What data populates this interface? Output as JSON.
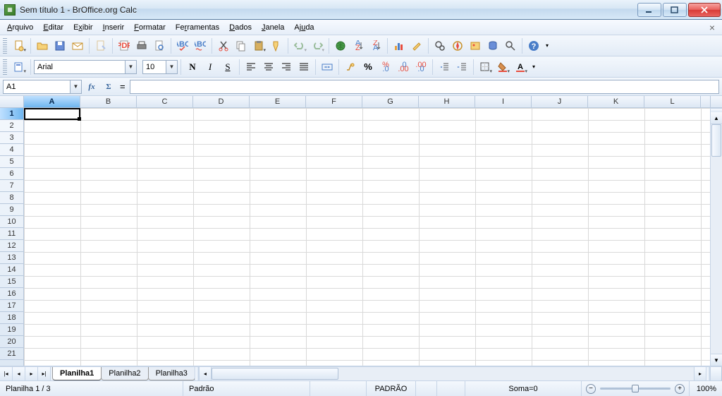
{
  "titlebar": {
    "title": "Sem título 1 - BrOffice.org Calc"
  },
  "menu": {
    "items": [
      {
        "label": "Arquivo",
        "accel": "A"
      },
      {
        "label": "Editar",
        "accel": "E"
      },
      {
        "label": "Exibir",
        "accel": "x"
      },
      {
        "label": "Inserir",
        "accel": "I"
      },
      {
        "label": "Formatar",
        "accel": "F"
      },
      {
        "label": "Ferramentas",
        "accel": "r"
      },
      {
        "label": "Dados",
        "accel": "D"
      },
      {
        "label": "Janela",
        "accel": "J"
      },
      {
        "label": "Ajuda",
        "accel": "u"
      }
    ]
  },
  "format_toolbar": {
    "font_name": "Arial",
    "font_size": "10",
    "bold_label": "N",
    "italic_label": "I",
    "underline_label": "S"
  },
  "formula_bar": {
    "cell_ref": "A1",
    "fx_label": "fx",
    "sigma_label": "Σ",
    "equals_label": "=",
    "formula_value": ""
  },
  "grid": {
    "columns": [
      "A",
      "B",
      "C",
      "D",
      "E",
      "F",
      "G",
      "H",
      "I",
      "J",
      "K",
      "L"
    ],
    "rows": [
      "1",
      "2",
      "3",
      "4",
      "5",
      "6",
      "7",
      "8",
      "9",
      "10",
      "11",
      "12",
      "13",
      "14",
      "15",
      "16",
      "17",
      "18",
      "19",
      "20",
      "21"
    ],
    "selected_col": "A",
    "selected_row": "1"
  },
  "sheets": {
    "tabs": [
      "Planilha1",
      "Planilha2",
      "Planilha3"
    ],
    "active": 0
  },
  "statusbar": {
    "sheet_indicator": "Planilha 1 / 3",
    "page_style": "Padrão",
    "mode": "PADRÃO",
    "sum": "Soma=0",
    "zoom": "100%"
  }
}
